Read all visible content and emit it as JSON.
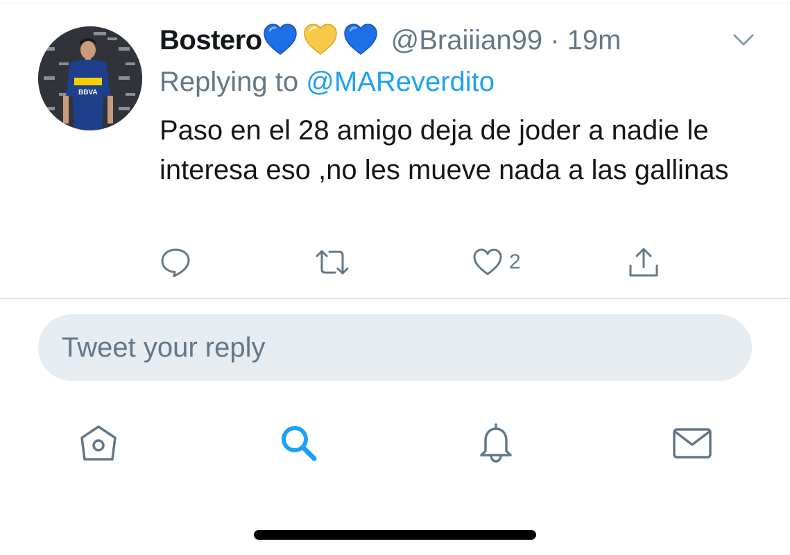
{
  "tweet": {
    "display_name": "Bostero",
    "emojis": [
      "blue-heart",
      "yellow-heart",
      "blue-heart"
    ],
    "handle_time": "@Braiiian99 · 19m",
    "replying_prefix": "Replying to ",
    "replying_to": "@MAReverdito",
    "text": "Paso en el 28 amigo deja de joder a nadie le interesa eso ,no les mueve nada a las gallinas",
    "like_count": "2",
    "avatar_jersey_text": "BBVA"
  },
  "actions": [
    "reply-icon",
    "retweet-icon",
    "like-icon",
    "share-icon"
  ],
  "reply_box": {
    "placeholder": "Tweet your reply"
  },
  "tabbar": [
    "home-icon",
    "search-icon",
    "notifications-icon",
    "messages-icon"
  ],
  "colors": {
    "accent": "#1da1f2",
    "secondary_text": "#657786",
    "primary_text": "#14171a",
    "heart_blue": "#1e6fe8",
    "heart_yellow": "#f7c948",
    "reply_box_bg": "#e6ecf0"
  }
}
